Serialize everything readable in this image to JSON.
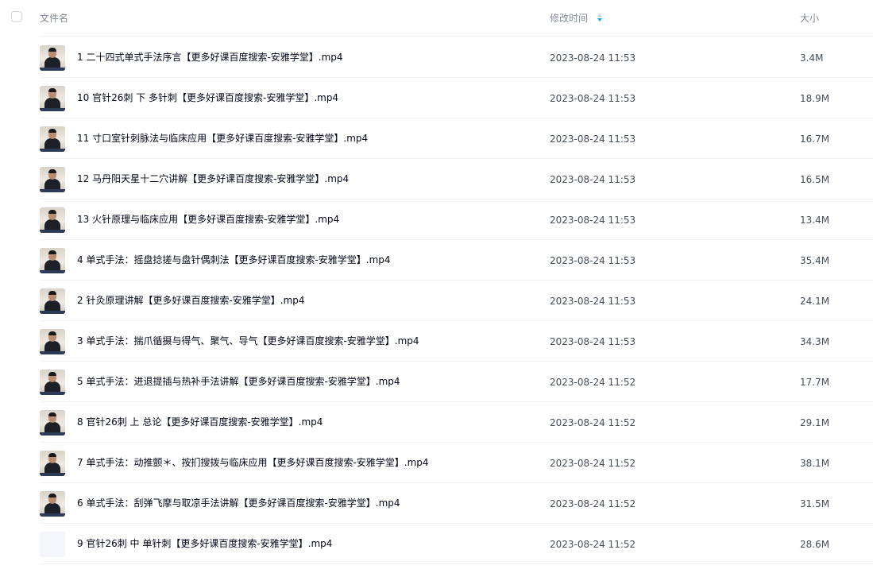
{
  "header": {
    "name": "文件名",
    "time": "修改时间",
    "size": "大小",
    "sort_icon": "sort-arrows-icon"
  },
  "files": [
    {
      "name": "1 二十四式单式手法序言【更多好课百度搜索-安雅学堂】.mp4",
      "time": "2023-08-24 11:53",
      "size": "3.4M",
      "thumb": "video-thumbnail"
    },
    {
      "name": "10 官针26刺 下 多针刺【更多好课百度搜索-安雅学堂】.mp4",
      "time": "2023-08-24 11:53",
      "size": "18.9M",
      "thumb": "video-thumbnail"
    },
    {
      "name": "11 寸口室针刺脉法与临床应用【更多好课百度搜索-安雅学堂】.mp4",
      "time": "2023-08-24 11:53",
      "size": "16.7M",
      "thumb": "video-thumbnail"
    },
    {
      "name": "12 马丹阳天星十二穴讲解【更多好课百度搜索-安雅学堂】.mp4",
      "time": "2023-08-24 11:53",
      "size": "16.5M",
      "thumb": "video-thumbnail"
    },
    {
      "name": "13 火针原理与临床应用【更多好课百度搜索-安雅学堂】.mp4",
      "time": "2023-08-24 11:53",
      "size": "13.4M",
      "thumb": "video-thumbnail"
    },
    {
      "name": "4 单式手法：摇盘捻搓与盘针偶刺法【更多好课百度搜索-安雅学堂】.mp4",
      "time": "2023-08-24 11:53",
      "size": "35.4M",
      "thumb": "video-thumbnail"
    },
    {
      "name": "2 针灸原理讲解【更多好课百度搜索-安雅学堂】.mp4",
      "time": "2023-08-24 11:53",
      "size": "24.1M",
      "thumb": "video-thumbnail"
    },
    {
      "name": "3 单式手法：揣爪循摄与得气、聚气、导气【更多好课百度搜索-安雅学堂】.mp4",
      "time": "2023-08-24 11:53",
      "size": "34.3M",
      "thumb": "video-thumbnail"
    },
    {
      "name": "5 单式手法：进退提插与热补手法讲解【更多好课百度搜索-安雅学堂】.mp4",
      "time": "2023-08-24 11:52",
      "size": "17.7M",
      "thumb": "video-thumbnail"
    },
    {
      "name": "8 官针26刺 上 总论【更多好课百度搜索-安雅学堂】.mp4",
      "time": "2023-08-24 11:52",
      "size": "29.1M",
      "thumb": "video-thumbnail"
    },
    {
      "name": "7 单式手法：动推颤＊、按扪搜拨与临床应用【更多好课百度搜索-安雅学堂】.mp4",
      "time": "2023-08-24 11:52",
      "size": "38.1M",
      "thumb": "video-thumbnail"
    },
    {
      "name": "6 单式手法：刮弹飞摩与取凉手法讲解【更多好课百度搜索-安雅学堂】.mp4",
      "time": "2023-08-24 11:52",
      "size": "31.5M",
      "thumb": "video-thumbnail"
    },
    {
      "name": "9 官针26刺 中 单针刺【更多好课百度搜索-安雅学堂】.mp4",
      "time": "2023-08-24 11:52",
      "size": "28.6M",
      "thumb": "blank-thumbnail"
    }
  ]
}
